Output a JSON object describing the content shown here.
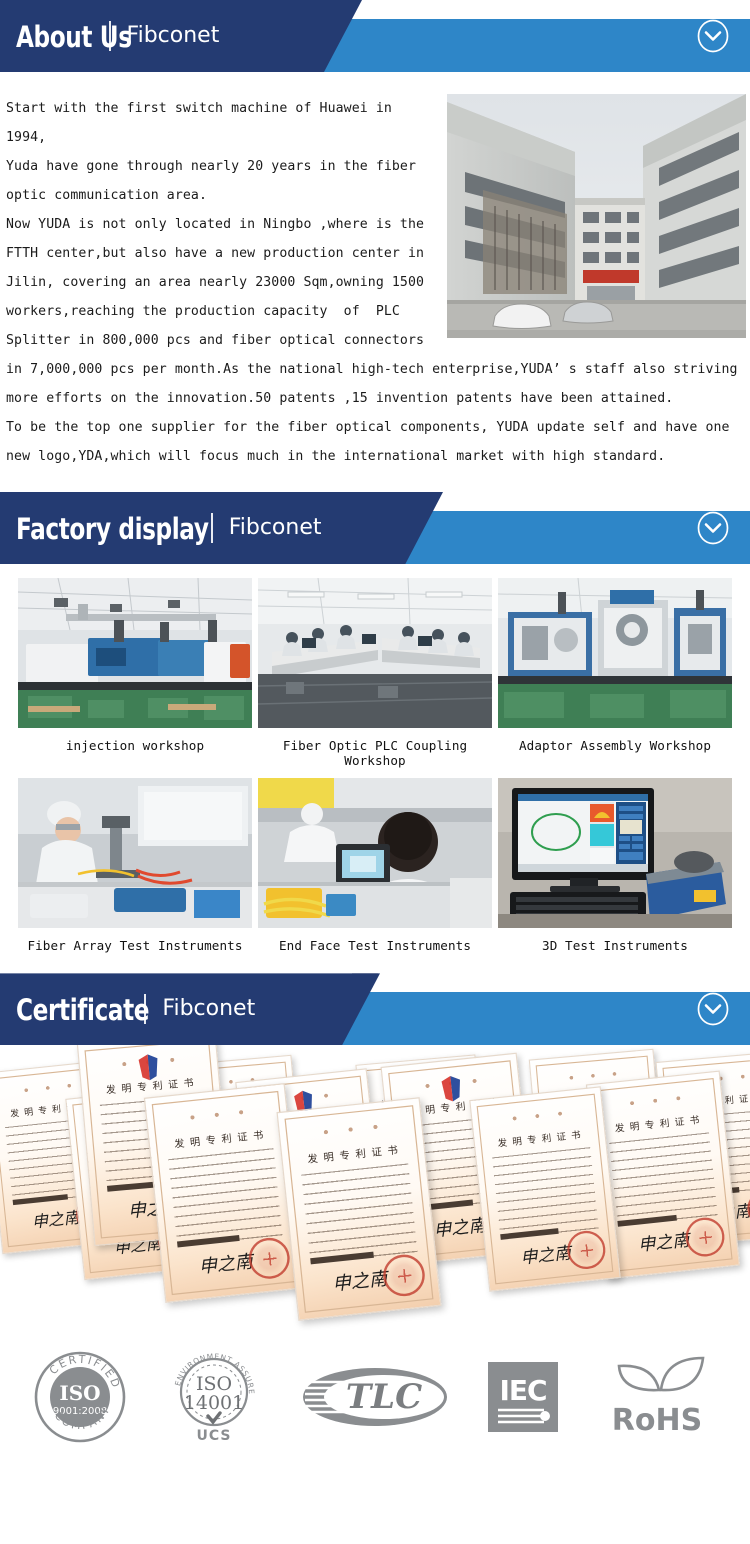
{
  "theme": {
    "navy": "#243b72",
    "navy_dark": "#16224a",
    "blue": "#2e86c8",
    "text": "#1b1b1b",
    "logo_gray": "#8a8d90",
    "seal_red": "#c0392b"
  },
  "sections": [
    {
      "id": "about",
      "title": "About Us",
      "brand": "Fibconet",
      "chevron_icon": "chevron-down-circle-icon"
    },
    {
      "id": "factory",
      "title": "Factory display",
      "brand": "Fibconet",
      "chevron_icon": "chevron-down-circle-icon"
    },
    {
      "id": "certificate",
      "title": "Certificate",
      "brand": "Fibconet",
      "chevron_icon": "chevron-down-circle-icon"
    }
  ],
  "about": {
    "paragraph": "Start with the first switch machine of Huawei in 1994,\nYuda have gone through nearly 20 years in the fiber\noptic communication area.\nNow YUDA is not only located in Ningbo ,where is the\nFTTH center,but also have a new production center in\nJilin, covering an area nearly 23000 Sqm,owning 1500\nworkers,reaching the production capacity  of  PLC\nSplitter in 800,000 pcs and fiber optical connectors\nin 7,000,000 pcs per month.As the national high-tech enterprise,YUDA’ s staff also striving\nmore efforts on the innovation.50 patents ,15 invention patents have been attained.\nTo be the top one supplier for the fiber optical components, YUDA update self and have one\nnew logo,YDA,which will focus much in the international market with high standard.",
    "photo_alt": "factory-building-exterior-photo"
  },
  "factory": {
    "rows": [
      [
        {
          "caption": "injection workshop",
          "photo": "injection-workshop-photo"
        },
        {
          "caption": "Fiber Optic PLC Coupling Workshop",
          "photo": "plc-coupling-workshop-photo"
        },
        {
          "caption": "Adaptor Assembly Workshop",
          "photo": "adaptor-assembly-workshop-photo"
        }
      ],
      [
        {
          "caption": "Fiber Array Test Instruments",
          "photo": "fiber-array-test-photo"
        },
        {
          "caption": "End Face Test Instruments",
          "photo": "end-face-test-photo"
        },
        {
          "caption": "3D Test Instruments",
          "photo": "3d-test-instruments-photo"
        }
      ]
    ]
  },
  "certificate": {
    "wall_alt": "chinese-invention-patent-certificates-collage",
    "certificate_title": "发 明 专 利 证 书",
    "signature": "申之南",
    "count": 12,
    "logos": [
      {
        "name": "iso-9001-certified-company-logo",
        "line1": "CERTIFIED",
        "line2": "ISO",
        "line3": "9001:2008",
        "line4": "COMPANY"
      },
      {
        "name": "iso-14001-ucs-logo",
        "line1": "ENVIRONMENT ASSURED FIRM",
        "line2": "ISO",
        "line3": "14001",
        "line4": "UCS"
      },
      {
        "name": "tlc-logo",
        "line1": "TLC"
      },
      {
        "name": "iec-logo",
        "line1": "IEC"
      },
      {
        "name": "rohs-logo",
        "line1": "RoHS"
      }
    ]
  }
}
